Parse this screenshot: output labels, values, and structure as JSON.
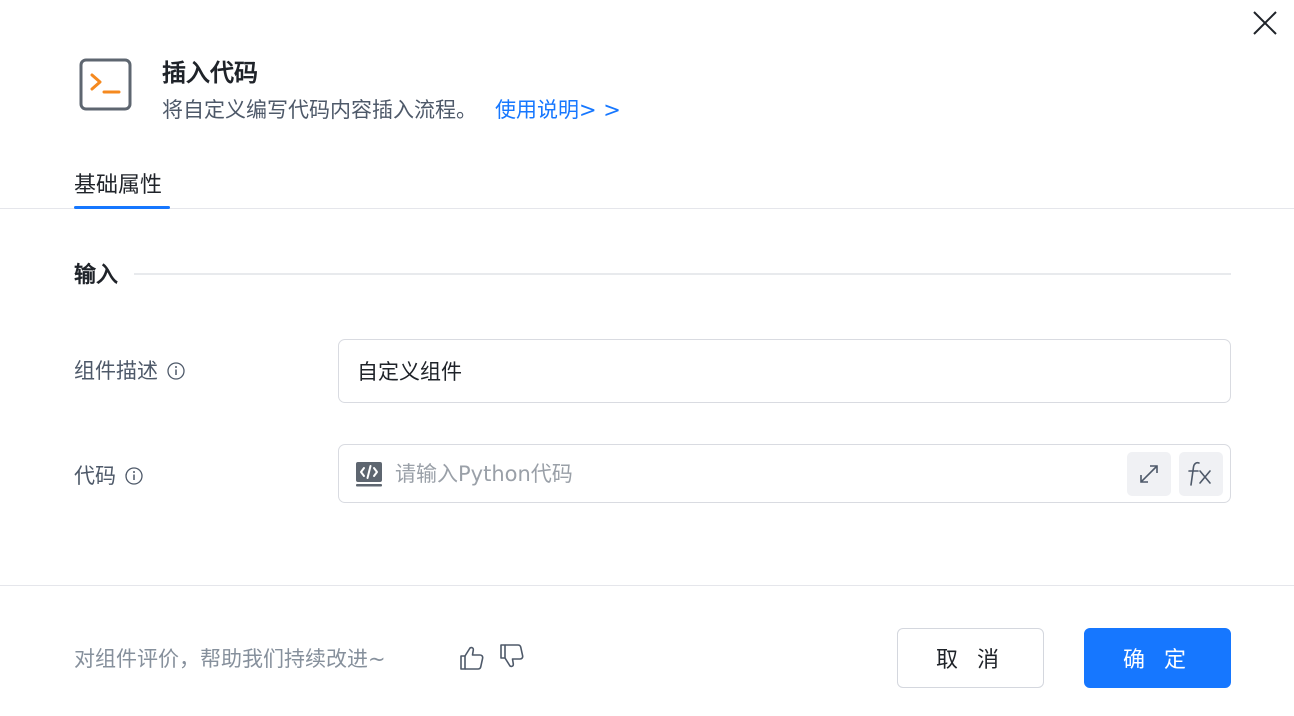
{
  "dialog": {
    "icon": "terminal-icon",
    "title": "插入代码",
    "subtitle": "将自定义编写代码内容插入流程。",
    "help_link": "使用说明> >",
    "close_icon": "close-icon"
  },
  "tabs": [
    {
      "label": "基础属性",
      "active": true
    }
  ],
  "section": {
    "title": "输入"
  },
  "fields": {
    "description": {
      "label": "组件描述",
      "value": "自定义组件"
    },
    "code": {
      "label": "代码",
      "placeholder": "请输入Python代码",
      "icon": "code-icon",
      "expand_icon": "expand-icon",
      "fx_icon": "fx-icon"
    }
  },
  "footer": {
    "feedback_text": "对组件评价，帮助我们持续改进~",
    "cancel_label": "取 消",
    "ok_label": "确 定"
  },
  "colors": {
    "accent": "#1677ff",
    "icon_orange": "#f5891f",
    "icon_frame": "#5e6670"
  }
}
